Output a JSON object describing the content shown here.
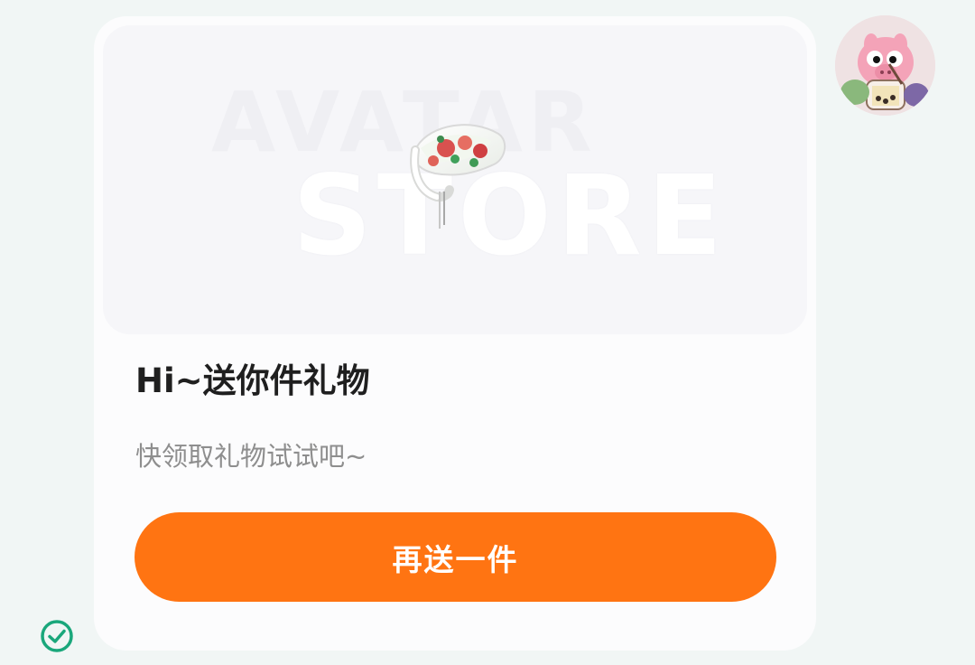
{
  "card": {
    "watermark_top": "AVATAR",
    "watermark_bottom": "STORE",
    "gift_image": "hair-clip-headband",
    "title": "Hi~送你件礼物",
    "subtitle": "快领取礼物试试吧~",
    "send_button_label": "再送一件"
  },
  "colors": {
    "accent": "#ff7412",
    "background": "#f1f6f5",
    "status": "#1aa77b"
  },
  "icons": {
    "avatar": "cartoon-pig-avatar",
    "status": "check-circle-icon"
  }
}
